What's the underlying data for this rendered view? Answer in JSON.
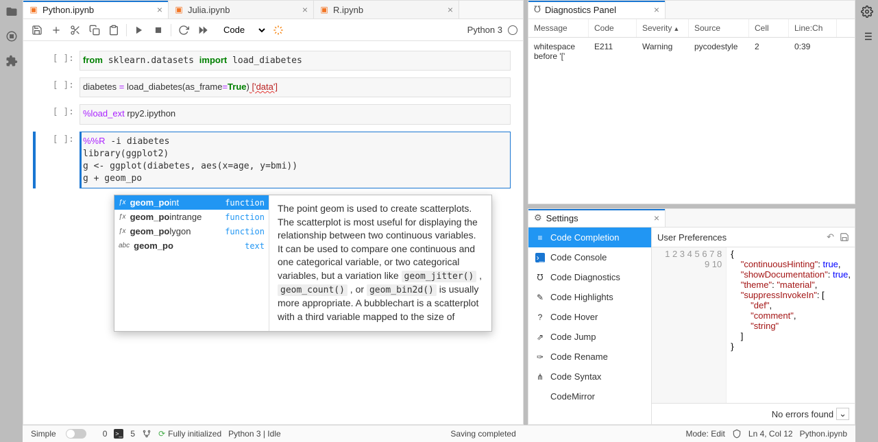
{
  "tabs": [
    {
      "label": "Python.ipynb",
      "active": true
    },
    {
      "label": "Julia.ipynb",
      "active": false
    },
    {
      "label": "R.ipynb",
      "active": false
    }
  ],
  "toolbar": {
    "cell_type": "Code",
    "kernel": "Python 3"
  },
  "cells": {
    "prompt": "[ ]:",
    "c1": "from sklearn.datasets import load_diabetes",
    "c2_lhs": "diabetes ",
    "c2_op": "=",
    "c2_call": " load_diabetes(as_frame",
    "c2_eq": "=",
    "c2_true": "True",
    "c2_rp": ")",
    "c2_err": " ['data']",
    "c3_magic": "%load_ext",
    "c3_rest": " rpy2.ipython",
    "c4": "%%R -i diabetes\nlibrary(ggplot2)\ng <- ggplot(diabetes, aes(x=age, y=bmi))\ng + geom_po"
  },
  "completion": {
    "items": [
      {
        "label": "geom_point",
        "match": "geom_po",
        "rest": "int",
        "kind": "function",
        "icon": "ƒx",
        "sel": true
      },
      {
        "label": "geom_pointrange",
        "match": "geom_po",
        "rest": "intrange",
        "kind": "function",
        "icon": "ƒx",
        "sel": false
      },
      {
        "label": "geom_polygon",
        "match": "geom_po",
        "rest": "lygon",
        "kind": "function",
        "icon": "ƒx",
        "sel": false
      },
      {
        "label": "geom_po",
        "match": "geom_po",
        "rest": "",
        "kind": "text",
        "icon": "abc",
        "sel": false
      }
    ],
    "doc_p1": "The point geom is used to create scatterplots. The scatterplot is most useful for displaying the relationship between two continuous variables. It can be used to compare one continuous and one categorical variable, or two categorical variables, but a variation like ",
    "code1": "geom_jitter()",
    "sep1": " , ",
    "code2": "geom_count()",
    "sep2": " , or ",
    "code3": "geom_bin2d()",
    "doc_p2": " is usually more appropriate. A bubblechart is a scatterplot with a third variable mapped to the size of"
  },
  "diagnostics": {
    "title": "Diagnostics Panel",
    "cols": {
      "msg": "Message",
      "code": "Code",
      "sev": "Severity",
      "src": "Source",
      "cell": "Cell",
      "line": "Line:Ch"
    },
    "row": {
      "msg": "whitespace before '['",
      "code": "E211",
      "sev": "Warning",
      "src": "pycodestyle",
      "cell": "2",
      "line": "0:39"
    }
  },
  "settings": {
    "title": "Settings",
    "nav": [
      "Code Completion",
      "Code Console",
      "Code Diagnostics",
      "Code Highlights",
      "Code Hover",
      "Code Jump",
      "Code Rename",
      "Code Syntax",
      "CodeMirror"
    ],
    "pref_title": "User Preferences",
    "json_lines": [
      "{",
      "    \"continuousHinting\": true,",
      "    \"showDocumentation\": true,",
      "    \"theme\": \"material\",",
      "    \"suppressInvokeIn\": [",
      "        \"def\",",
      "        \"comment\",",
      "        \"string\"",
      "    ]",
      "}"
    ],
    "footer": "No errors found"
  },
  "status": {
    "simple": "Simple",
    "n0": "0",
    "n1": "5",
    "init": "Fully initialized",
    "kernel": "Python 3 | Idle",
    "saving": "Saving completed",
    "mode": "Mode: Edit",
    "pos": "Ln 4, Col 12",
    "file": "Python.ipynb"
  }
}
